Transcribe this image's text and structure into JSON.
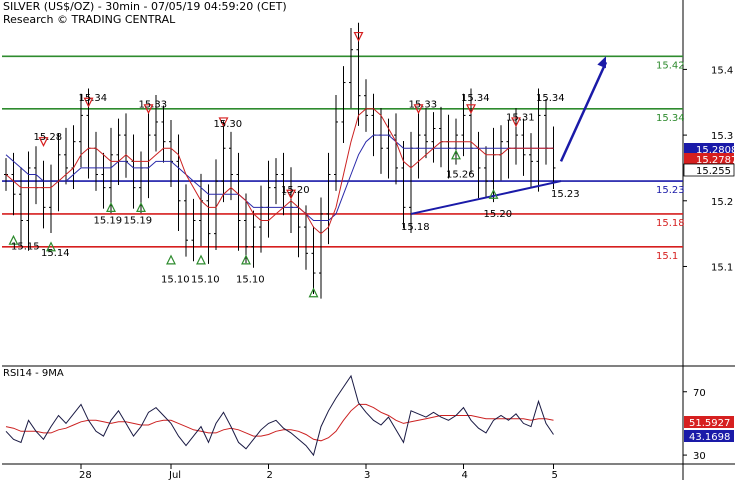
{
  "header": {
    "title": "SILVER (US$/OZ) - 30min - 07/05/19 04:59:20 (CET)",
    "credit": "Research © TRADING CENTRAL"
  },
  "rsi_panel": {
    "title": "RSI14 - 9MA"
  },
  "colors": {
    "resistance": "#2e8b2e",
    "support": "#d61f1f",
    "pivot": "#1a1aa8",
    "price": "#000000",
    "ma_fast": "#cc2222",
    "ma_slow": "#2a2aaa",
    "arrow": "#1a1aa8"
  },
  "chart_data": [
    {
      "type": "line",
      "panel": "price",
      "ylim": [
        14.95,
        15.46
      ],
      "y_ticks": [
        "15.4",
        "15.3",
        "15.2",
        "15.1"
      ],
      "x_ticks": [
        "28",
        "Jul",
        "2",
        "3",
        "4",
        "5"
      ],
      "current_labels": [
        {
          "value": "15.2808",
          "style": "box",
          "color": "#1a1aa8"
        },
        {
          "value": "15.2787",
          "style": "box",
          "color": "#d61f1f"
        },
        {
          "value": "15.255",
          "style": "box",
          "color": "#ffffff"
        }
      ],
      "levels": [
        {
          "label": "15.42",
          "value": 15.42,
          "kind": "resistance"
        },
        {
          "label": "15.34",
          "value": 15.34,
          "kind": "resistance"
        },
        {
          "label": "15.23",
          "value": 15.23,
          "kind": "pivot"
        },
        {
          "label": "15.18",
          "value": 15.18,
          "kind": "support"
        },
        {
          "label": "15.1",
          "value": 15.13,
          "kind": "support"
        }
      ],
      "close_series": [
        15.24,
        15.21,
        15.17,
        15.25,
        15.22,
        15.19,
        15.23,
        15.27,
        15.25,
        15.29,
        15.33,
        15.28,
        15.24,
        15.22,
        15.27,
        15.3,
        15.26,
        15.22,
        15.25,
        15.3,
        15.32,
        15.29,
        15.26,
        15.2,
        15.14,
        15.17,
        15.2,
        15.15,
        15.23,
        15.28,
        15.24,
        15.17,
        15.13,
        15.16,
        15.19,
        15.22,
        15.24,
        15.21,
        15.19,
        15.16,
        15.12,
        15.09,
        15.18,
        15.24,
        15.32,
        15.38,
        15.43,
        15.36,
        15.33,
        15.3,
        15.28,
        15.3,
        15.25,
        15.19,
        15.28,
        15.3,
        15.29,
        15.31,
        15.29,
        15.28,
        15.3,
        15.33,
        15.28,
        15.25,
        15.23,
        15.27,
        15.29,
        15.28,
        15.3,
        15.27,
        15.26,
        15.33,
        15.28,
        15.25
      ],
      "ma_fast": [
        15.24,
        15.23,
        15.22,
        15.22,
        15.22,
        15.22,
        15.22,
        15.23,
        15.24,
        15.25,
        15.27,
        15.28,
        15.28,
        15.27,
        15.26,
        15.26,
        15.27,
        15.26,
        15.26,
        15.26,
        15.27,
        15.28,
        15.28,
        15.27,
        15.24,
        15.22,
        15.2,
        15.19,
        15.19,
        15.21,
        15.22,
        15.21,
        15.2,
        15.18,
        15.17,
        15.17,
        15.18,
        15.19,
        15.2,
        15.19,
        15.18,
        15.16,
        15.15,
        15.16,
        15.19,
        15.24,
        15.29,
        15.33,
        15.34,
        15.34,
        15.33,
        15.31,
        15.29,
        15.26,
        15.25,
        15.26,
        15.27,
        15.28,
        15.29,
        15.29,
        15.29,
        15.29,
        15.29,
        15.28,
        15.27,
        15.27,
        15.27,
        15.28,
        15.28,
        15.28,
        15.28,
        15.28,
        15.28,
        15.28
      ],
      "ma_slow": [
        15.27,
        15.26,
        15.25,
        15.24,
        15.24,
        15.23,
        15.23,
        15.23,
        15.23,
        15.24,
        15.25,
        15.25,
        15.25,
        15.25,
        15.25,
        15.26,
        15.26,
        15.25,
        15.25,
        15.25,
        15.26,
        15.26,
        15.26,
        15.25,
        15.24,
        15.23,
        15.22,
        15.21,
        15.21,
        15.21,
        15.21,
        15.21,
        15.2,
        15.19,
        15.19,
        15.19,
        15.19,
        15.19,
        15.19,
        15.19,
        15.18,
        15.17,
        15.17,
        15.17,
        15.18,
        15.21,
        15.24,
        15.27,
        15.29,
        15.3,
        15.3,
        15.3,
        15.29,
        15.28,
        15.28,
        15.28,
        15.28,
        15.28,
        15.28,
        15.28,
        15.28,
        15.28,
        15.28,
        15.28,
        15.28,
        15.28,
        15.28,
        15.28,
        15.28,
        15.28,
        15.28,
        15.28,
        15.28,
        15.28
      ],
      "annotations": [
        {
          "text": "15.15",
          "i": 2,
          "value": 15.15,
          "kind": "low"
        },
        {
          "text": "15.28",
          "i": 5,
          "value": 15.28,
          "kind": "high"
        },
        {
          "text": "15.14",
          "i": 6,
          "value": 15.14,
          "kind": "low"
        },
        {
          "text": "15.34",
          "i": 11,
          "value": 15.34,
          "kind": "high"
        },
        {
          "text": "15.19",
          "i": 13,
          "value": 15.19,
          "kind": "low"
        },
        {
          "text": "15.19",
          "i": 17,
          "value": 15.19,
          "kind": "low"
        },
        {
          "text": "15.33",
          "i": 19,
          "value": 15.33,
          "kind": "high"
        },
        {
          "text": "15.10",
          "i": 22,
          "value": 15.1,
          "kind": "low"
        },
        {
          "text": "15.10",
          "i": 26,
          "value": 15.1,
          "kind": "low"
        },
        {
          "text": "15.30",
          "i": 29,
          "value": 15.3,
          "kind": "high"
        },
        {
          "text": "15.10",
          "i": 32,
          "value": 15.1,
          "kind": "low"
        },
        {
          "text": "15.20",
          "i": 38,
          "value": 15.2,
          "kind": "high"
        },
        {
          "text": "15.18",
          "i": 54,
          "value": 15.18,
          "kind": "low"
        },
        {
          "text": "15.33",
          "i": 55,
          "value": 15.33,
          "kind": "high"
        },
        {
          "text": "15.26",
          "i": 60,
          "value": 15.26,
          "kind": "low"
        },
        {
          "text": "15.34",
          "i": 62,
          "value": 15.34,
          "kind": "high"
        },
        {
          "text": "15.20",
          "i": 65,
          "value": 15.2,
          "kind": "low"
        },
        {
          "text": "15.31",
          "i": 68,
          "value": 15.31,
          "kind": "high"
        },
        {
          "text": "15.34",
          "i": 72,
          "value": 15.34,
          "kind": "high"
        },
        {
          "text": "15.23",
          "i": 74,
          "value": 15.23,
          "kind": "low"
        }
      ],
      "triangle_markers": [
        {
          "i": 1,
          "value": 15.14,
          "dir": "up"
        },
        {
          "i": 5,
          "value": 15.29,
          "dir": "down"
        },
        {
          "i": 6,
          "value": 15.13,
          "dir": "up"
        },
        {
          "i": 11,
          "value": 15.35,
          "dir": "down"
        },
        {
          "i": 14,
          "value": 15.19,
          "dir": "up"
        },
        {
          "i": 18,
          "value": 15.19,
          "dir": "up"
        },
        {
          "i": 19,
          "value": 15.34,
          "dir": "down"
        },
        {
          "i": 22,
          "value": 15.11,
          "dir": "up"
        },
        {
          "i": 26,
          "value": 15.11,
          "dir": "up"
        },
        {
          "i": 29,
          "value": 15.32,
          "dir": "down"
        },
        {
          "i": 32,
          "value": 15.11,
          "dir": "up"
        },
        {
          "i": 38,
          "value": 15.21,
          "dir": "down"
        },
        {
          "i": 41,
          "value": 15.06,
          "dir": "up"
        },
        {
          "i": 47,
          "value": 15.45,
          "dir": "down"
        },
        {
          "i": 55,
          "value": 15.34,
          "dir": "down"
        },
        {
          "i": 60,
          "value": 15.27,
          "dir": "up"
        },
        {
          "i": 62,
          "value": 15.34,
          "dir": "down"
        },
        {
          "i": 65,
          "value": 15.21,
          "dir": "up"
        },
        {
          "i": 68,
          "value": 15.32,
          "dir": "down"
        }
      ],
      "trendline": {
        "from": {
          "i": 54,
          "value": 15.18
        },
        "to": {
          "i": 74,
          "value": 15.23
        }
      },
      "forecast_arrow": {
        "from": {
          "i": 74,
          "value": 15.26
        },
        "to": {
          "i": 80,
          "value": 15.42
        }
      }
    },
    {
      "type": "line",
      "panel": "rsi",
      "ylim": [
        25,
        85
      ],
      "y_ticks": [
        "70",
        "30"
      ],
      "current_labels": [
        {
          "value": "51.5927",
          "style": "box",
          "color": "#d61f1f"
        },
        {
          "value": "43.1698",
          "style": "box",
          "color": "#1a1aa8"
        }
      ],
      "rsi": [
        45,
        40,
        38,
        52,
        45,
        40,
        48,
        55,
        50,
        56,
        62,
        52,
        45,
        42,
        52,
        58,
        50,
        42,
        48,
        57,
        60,
        55,
        50,
        42,
        36,
        42,
        48,
        38,
        50,
        57,
        48,
        38,
        34,
        40,
        46,
        50,
        52,
        47,
        44,
        40,
        36,
        30,
        48,
        58,
        66,
        73,
        80,
        63,
        57,
        52,
        49,
        54,
        46,
        38,
        58,
        56,
        54,
        57,
        54,
        52,
        55,
        60,
        52,
        47,
        44,
        52,
        55,
        52,
        56,
        50,
        48,
        64,
        50,
        43
      ],
      "rsi_ma": [
        48,
        47,
        45,
        45,
        45,
        44,
        44,
        46,
        47,
        49,
        51,
        52,
        52,
        51,
        50,
        51,
        51,
        50,
        49,
        49,
        51,
        52,
        52,
        50,
        48,
        46,
        45,
        44,
        44,
        46,
        47,
        46,
        44,
        42,
        42,
        43,
        45,
        46,
        46,
        45,
        43,
        40,
        39,
        41,
        45,
        52,
        58,
        62,
        62,
        60,
        57,
        55,
        52,
        50,
        51,
        52,
        53,
        54,
        55,
        55,
        55,
        55,
        55,
        54,
        53,
        53,
        53,
        53,
        53,
        53,
        52,
        53,
        53,
        52
      ]
    }
  ]
}
